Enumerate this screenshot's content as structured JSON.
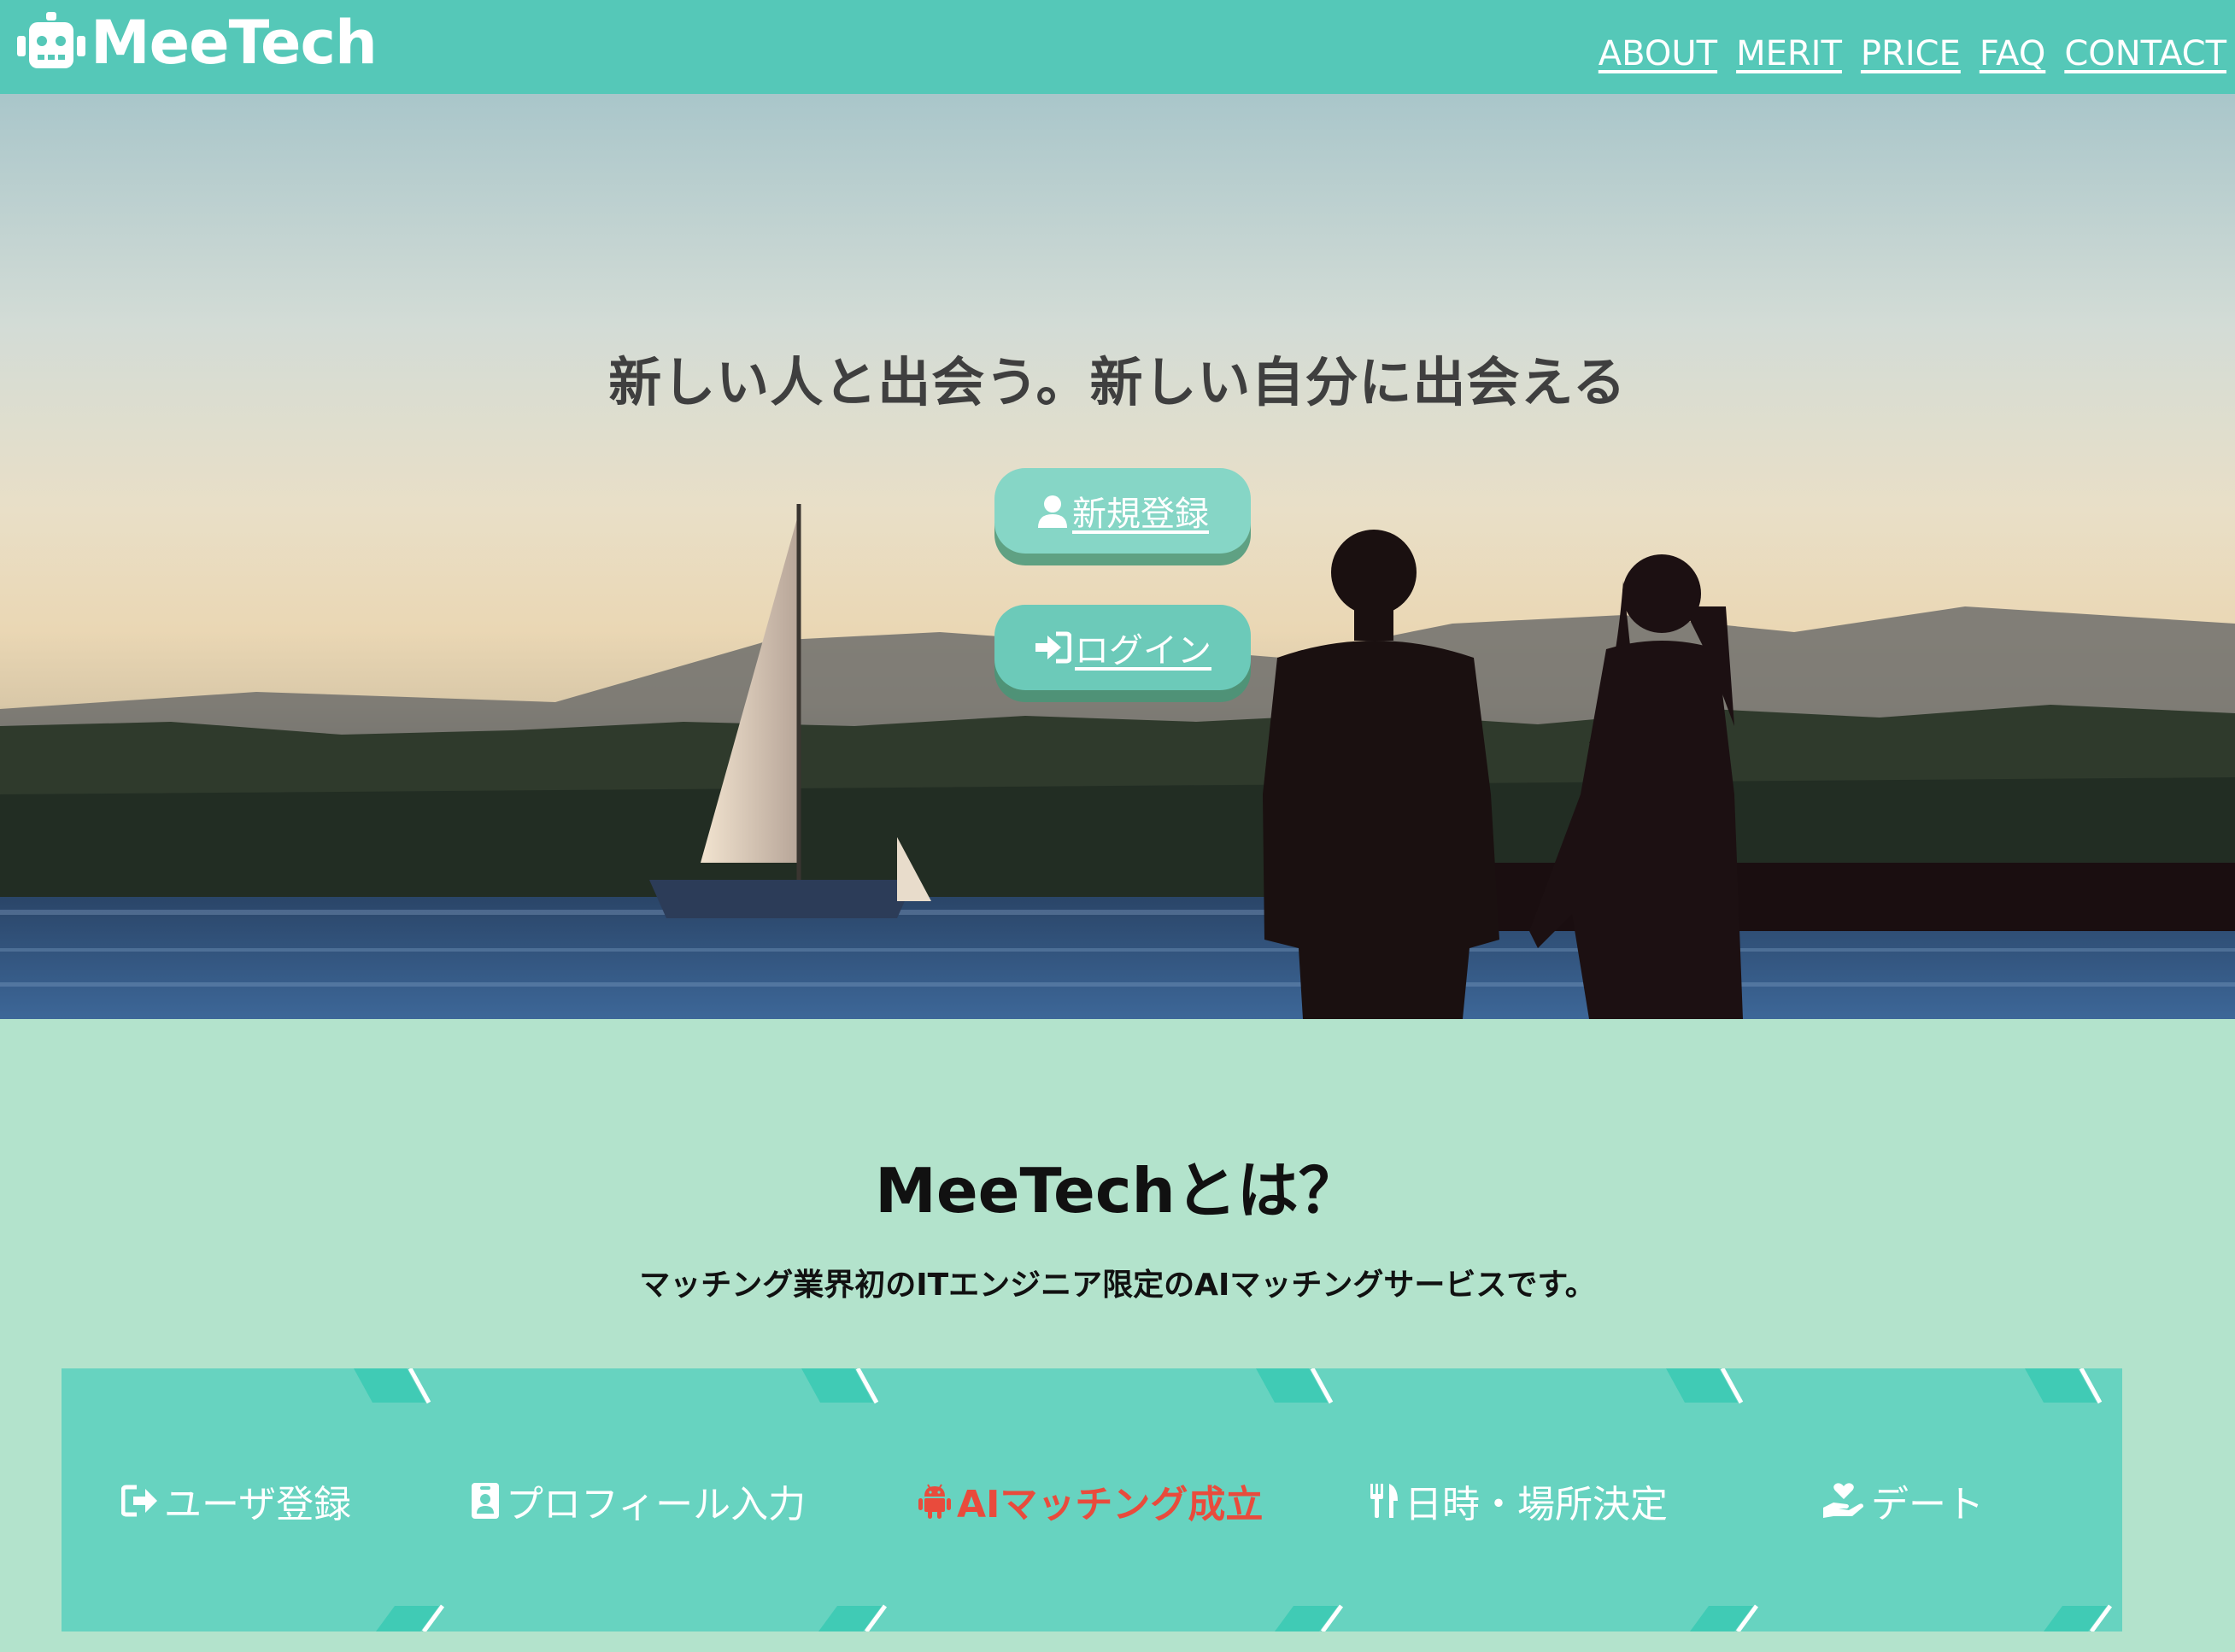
{
  "header": {
    "logo_text": "MeeTech",
    "logo_icon": "robot-icon",
    "nav": [
      "ABOUT",
      "MERIT",
      "PRICE",
      "FAQ",
      "CONTACT"
    ]
  },
  "hero": {
    "tagline": "新しい人と出会う。新しい自分に出会える",
    "register_label": "新規登録",
    "register_icon": "user-icon",
    "login_label": "ログイン",
    "login_icon": "sign-in-icon"
  },
  "about": {
    "title": "MeeTechとは？",
    "description": "マッチング業界初のITエンジニア限定のAIマッチングサービスです。"
  },
  "steps": [
    {
      "label": "ユーザ登録",
      "icon": "sign-out-icon",
      "active": false
    },
    {
      "label": "プロフィール入力",
      "icon": "id-badge-icon",
      "active": false
    },
    {
      "label": "AIマッチング成立",
      "icon": "android-icon",
      "active": true
    },
    {
      "label": "日時・場所決定",
      "icon": "utensils-icon",
      "active": false
    },
    {
      "label": "デート",
      "icon": "hand-holding-heart-icon",
      "active": false
    }
  ],
  "colors": {
    "header_bg": "#55c8b8",
    "page_bg": "#b3e3cc",
    "steps_bg": "#67d3c0",
    "active_step": "#e94b3c"
  }
}
